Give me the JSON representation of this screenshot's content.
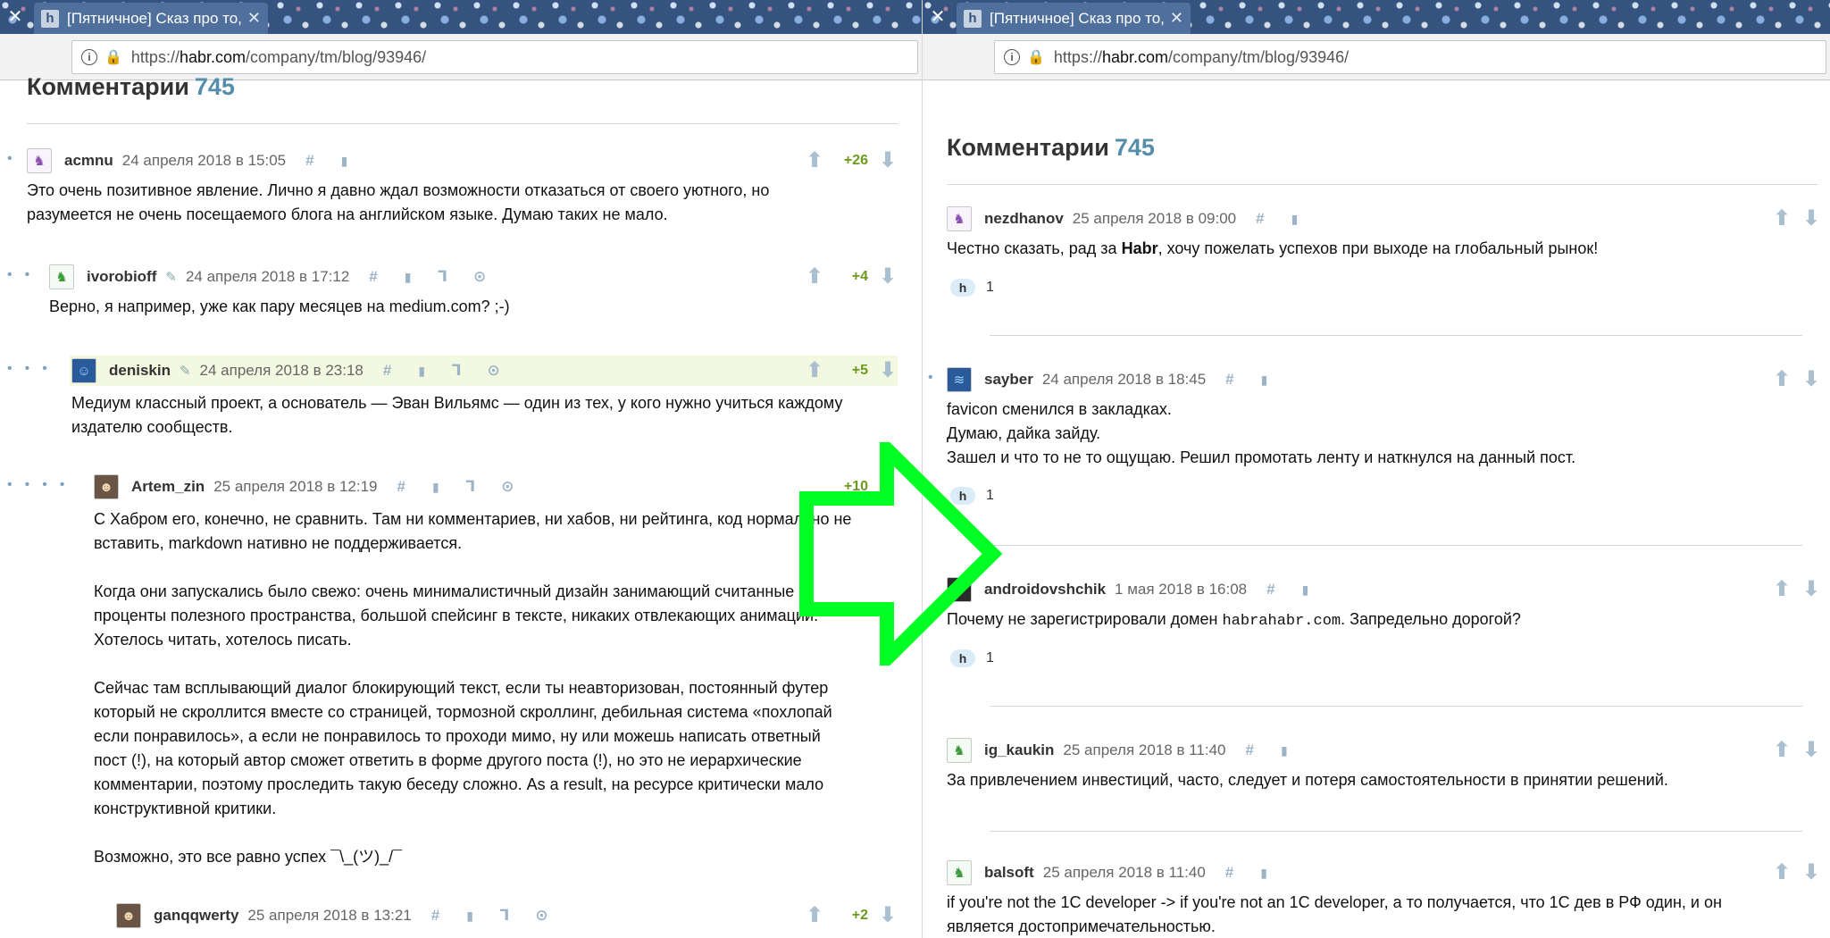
{
  "browser": {
    "tab_close_glyph": "✕",
    "tab_title": "[Пятничное] Сказ про то,",
    "tab_x_glyph": "✕",
    "favicon_letter": "h",
    "url_scheme": "https://",
    "url_host": "habr.com",
    "url_path": "/company/tm/blog/93946/"
  },
  "left": {
    "section_title": "Комментарии",
    "section_count": "745",
    "comments": [
      {
        "user": "acmnu",
        "date": "24 апреля 2018 в 15:05",
        "score": "+26",
        "text": [
          "Это очень позитивное явление. Лично я давно ждал возможности отказаться от своего уютного, но",
          "разумеется не очень посещаемого блога на английском языке. Думаю таких не мало."
        ]
      },
      {
        "user": "ivorobioff",
        "date": "24 апреля 2018 в 17:12",
        "score": "+4",
        "text": [
          "Верно, я например, уже как пару месяцев на medium.com? ;-)"
        ]
      },
      {
        "user": "deniskin",
        "date": "24 апреля 2018 в 23:18",
        "score": "+5",
        "text": [
          "Медиум классный проект, а основатель — Эван Вильямс — один из тех, у кого нужно учиться каждому",
          "издателю сообществ."
        ]
      },
      {
        "user": "Artem_zin",
        "date": "25 апреля 2018 в 12:19",
        "score": "+10",
        "text": [
          "С Хабром его, конечно, не сравнить. Там ни комментариев, ни хабов, ни рейтинга, код нормально не",
          "вставить, markdown нативно не поддерживается.",
          "",
          "Когда они запускались было свежо: очень минималистичный дизайн занимающий считанные",
          "проценты полезного пространства, большой спейсинг в тексте, никаких отвлекающих анимаций.",
          "Хотелось читать, хотелось писать.",
          "",
          "Сейчас там всплывающий диалог блокирующий текст, если ты неавторизован, постоянный футер",
          "который не скроллится вместе со страницей, тормозной скроллинг, дебильная система «похлопай",
          "если понравилось», а если не понравилось то проходи мимо, ну или можешь написать ответный",
          "пост (!), на который автор сможет ответить в форме другого поста (!), но это не иерархические",
          "комментарии, поэтому проследить такую беседу сложно. As a result, на ресурсе критически мало",
          "конструктивной критики.",
          "",
          "Возможно, это все равно успех ¯\\_(ツ)_/¯"
        ]
      },
      {
        "user": "ganqqwerty",
        "date": "25 апреля 2018 в 13:21",
        "score": "+2",
        "text": []
      }
    ]
  },
  "right": {
    "section_title": "Комментарии",
    "section_count": "745",
    "comments": [
      {
        "user": "nezdhanov",
        "date": "25 апреля 2018 в 09:00",
        "text_before": "Честно сказать, рад за ",
        "text_bold": "Habr",
        "text_after": ", хочу пожелать успехов при выходе на глобальный рынок!",
        "replies": "1"
      },
      {
        "user": "sayber",
        "date": "24 апреля 2018 в 18:45",
        "text": [
          "favicon сменился в закладках.",
          "Думаю, дайка зайду.",
          "Зашел и что то не то ощущаю. Решил промотать ленту и наткнулся на данный пост."
        ],
        "replies": "1"
      },
      {
        "user": "androidovshchik",
        "date": "1 мая 2018 в 16:08",
        "text_before": "Почему не зарегистрировали домен ",
        "text_code": "habrahabr.com",
        "text_after": ". Запредельно дорогой?",
        "replies": "1"
      },
      {
        "user": "ig_kaukin",
        "date": "25 апреля 2018 в 11:40",
        "text": [
          "За привлечением инвестиций, часто, следует и потеря самостоятельности в принятии решений."
        ]
      },
      {
        "user": "balsoft",
        "date": "25 апреля 2018 в 11:40",
        "text": [
          "if you're not the 1C developer -> if you're not an 1C developer, а то получается, что 1С дев в РФ один, и он",
          "является достопримечательностью."
        ]
      }
    ]
  },
  "icons": {
    "hash": "#",
    "bookmark": "🔖",
    "up": "⬆",
    "down": "⬇",
    "reply_tree": "⅂",
    "pencil": "✎",
    "circle_up": "⊙",
    "badge": "h"
  },
  "colors": {
    "accent_green": "#00ff22",
    "score_green": "#6c9a1f",
    "count_blue": "#548eaa",
    "tabbar": "#34537f"
  }
}
